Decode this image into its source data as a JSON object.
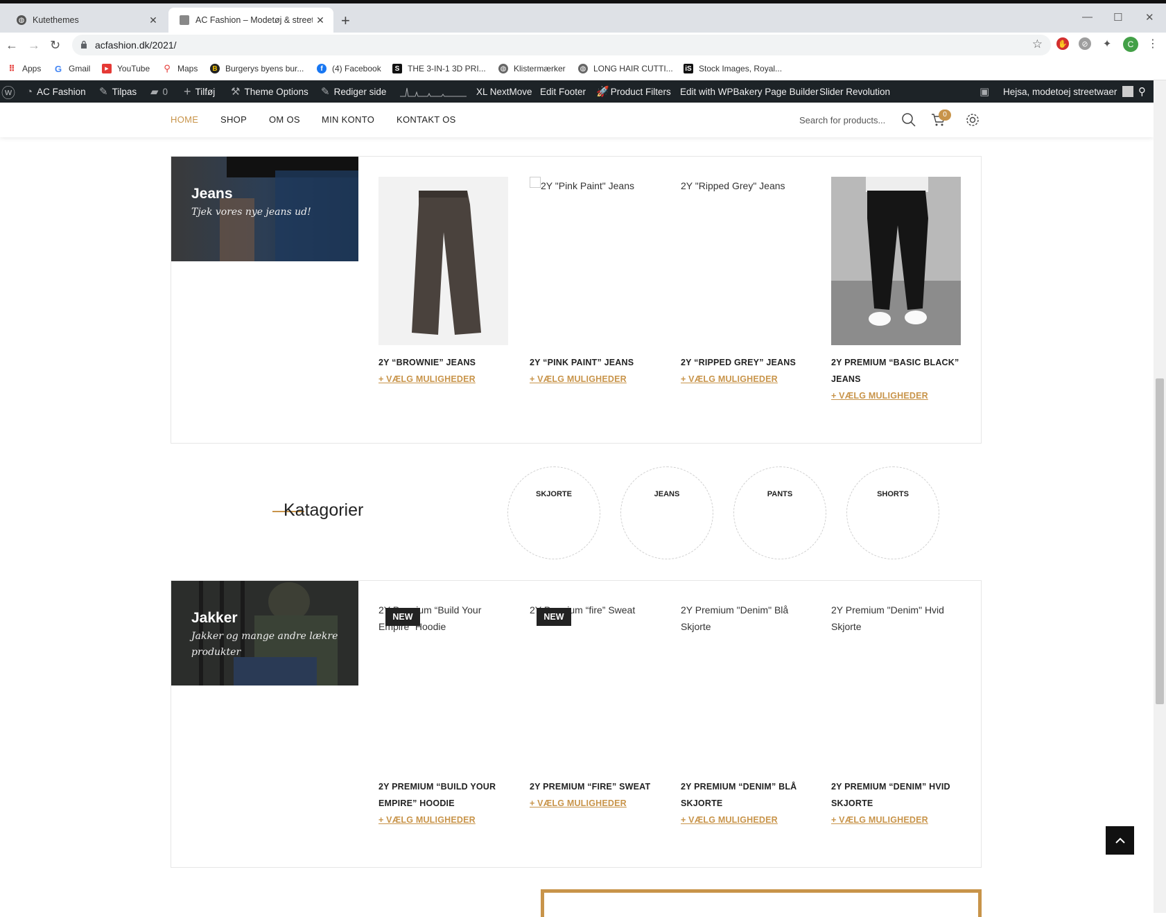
{
  "browser": {
    "tabs": [
      {
        "title": "Kutethemes",
        "active": false
      },
      {
        "title": "AC Fashion – Modetøj & streetwear",
        "active": true
      }
    ],
    "url": "acfashion.dk/2021/",
    "bookmarks": [
      "Apps",
      "Gmail",
      "YouTube",
      "Maps",
      "Burgerys byens bur...",
      "(4) Facebook",
      "THE 3-IN-1 3D PRI...",
      "Klistermærker",
      "LONG HAIR CUTTI...",
      "Stock Images, Royal..."
    ],
    "profile_initial": "C"
  },
  "wp_admin_bar": {
    "site_name": "AC Fashion",
    "customize": "Tilpas",
    "comments_count": "0",
    "new": "Tilføj",
    "theme_options": "Theme Options",
    "edit_page": "Rediger side",
    "xl_nextmove": "XL NextMove",
    "edit_footer": "Edit Footer",
    "product_filters": "Product Filters",
    "wpbakery": "Edit with WPBakery Page Builder",
    "slider_revolution": "Slider Revolution",
    "greeting": "Hejsa, modetoej streetwaer"
  },
  "site_nav": {
    "items": [
      "HOME",
      "SHOP",
      "OM OS",
      "MIN KONTO",
      "KONTAKT OS"
    ],
    "search_placeholder": "Search for products...",
    "cart_count": "0"
  },
  "jeans_section": {
    "banner_title": "Jeans",
    "banner_subtitle": "Tjek vores nye jeans ud!",
    "products": [
      {
        "name": "2Y “BROWNIE” JEANS",
        "alt": "",
        "action": "+ VÆLG MULIGHEDER"
      },
      {
        "name": "2Y “PINK PAINT” JEANS",
        "alt": "2Y \"Pink Paint\" Jeans",
        "action": "+ VÆLG MULIGHEDER"
      },
      {
        "name": "2Y “RIPPED GREY” JEANS",
        "alt": "2Y \"Ripped Grey\" Jeans",
        "action": "+ VÆLG MULIGHEDER"
      },
      {
        "name": "2Y PREMIUM “BASIC BLACK” JEANS",
        "alt": "",
        "action": "+ VÆLG MULIGHEDER"
      }
    ]
  },
  "categories": {
    "title": "Katagorier",
    "items": [
      "SKJORTE",
      "JEANS",
      "PANTS",
      "SHORTS"
    ]
  },
  "jakker_section": {
    "banner_title": "Jakker",
    "banner_subtitle": "Jakker og mange andre lækre produkter",
    "products": [
      {
        "name": "2Y PREMIUM “BUILD YOUR EMPIRE” HOODIE",
        "alt": "2Y Premium “Build Your Empire” Hoodie",
        "badge": "NEW",
        "action": "+ VÆLG MULIGHEDER"
      },
      {
        "name": "2Y PREMIUM “FIRE” SWEAT",
        "alt": "2Y Premium “fire” Sweat",
        "badge": "NEW",
        "action": "+ VÆLG MULIGHEDER"
      },
      {
        "name": "2Y PREMIUM “DENIM” BLÅ SKJORTE",
        "alt": "2Y Premium \"Denim\" Blå Skjorte",
        "badge": "",
        "action": "+ VÆLG MULIGHEDER"
      },
      {
        "name": "2Y PREMIUM “DENIM” HVID SKJORTE",
        "alt": "2Y Premium \"Denim\" Hvid Skjorte",
        "badge": "",
        "action": "+ VÆLG MULIGHEDER"
      }
    ]
  },
  "colors": {
    "accent": "#c8944a",
    "admin_bar": "#1d2327"
  }
}
